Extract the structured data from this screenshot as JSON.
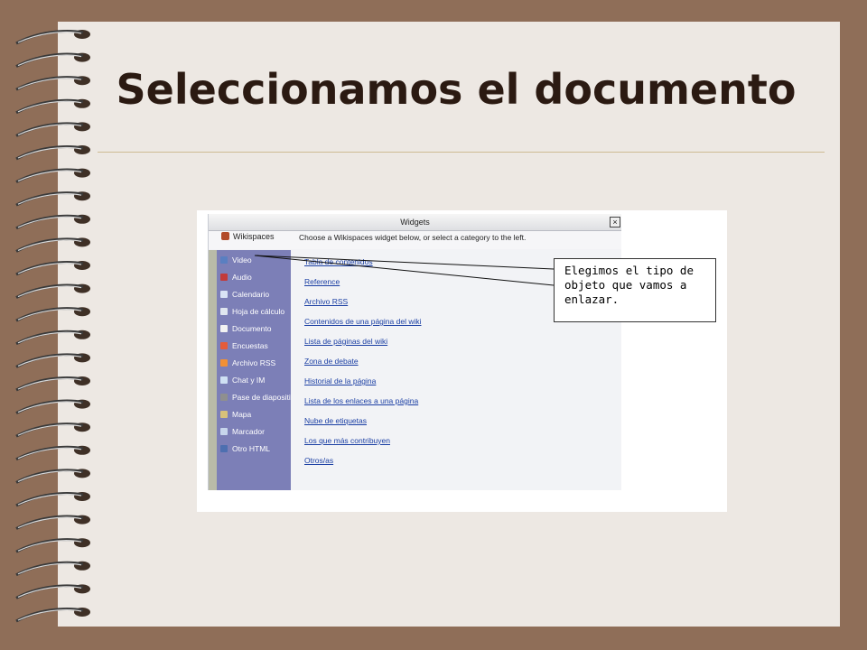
{
  "slide": {
    "title": "Seleccionamos el documento"
  },
  "window": {
    "title": "Widgets",
    "close_glyph": "×",
    "brand": "Wikispaces",
    "instructions": "Choose a Wikispaces widget below, or select a category to the left."
  },
  "sidebar": {
    "items": [
      {
        "label": "Video",
        "icon": "video-icon",
        "color": "#5a7fc1"
      },
      {
        "label": "Audio",
        "icon": "audio-icon",
        "color": "#c23b3b"
      },
      {
        "label": "Calendario",
        "icon": "calendar-icon",
        "color": "#d9e3f5"
      },
      {
        "label": "Hoja de cálculo",
        "icon": "spreadsheet-icon",
        "color": "#dfe6ef"
      },
      {
        "label": "Documento",
        "icon": "document-icon",
        "color": "#f2f2f2"
      },
      {
        "label": "Encuestas",
        "icon": "poll-icon",
        "color": "#e55c3a"
      },
      {
        "label": "Archivo RSS",
        "icon": "rss-icon",
        "color": "#f29035"
      },
      {
        "label": "Chat y IM",
        "icon": "chat-icon",
        "color": "#cfe0f3"
      },
      {
        "label": "Pase de diapositivas",
        "icon": "slideshow-icon",
        "color": "#8f8f8f"
      },
      {
        "label": "Mapa",
        "icon": "map-icon",
        "color": "#d8c27a"
      },
      {
        "label": "Marcador",
        "icon": "bookmark-icon",
        "color": "#c7d6ec"
      },
      {
        "label": "Otro HTML",
        "icon": "html-icon",
        "color": "#4d6fb0"
      }
    ]
  },
  "widgets": {
    "items": [
      "Tabla de contenidos",
      "Reference",
      "Archivo RSS",
      "Contenidos de una página del wiki",
      "Lista de páginas del wiki",
      "Zona de debate",
      "Historial de la página",
      "Lista de los enlaces a una página",
      "Nube de etiquetas",
      "Los que más contribuyen",
      "Otros/as"
    ]
  },
  "callout": {
    "lines": [
      "Elegimos el tipo de",
      "objeto que vamos a",
      "enlazar."
    ]
  }
}
